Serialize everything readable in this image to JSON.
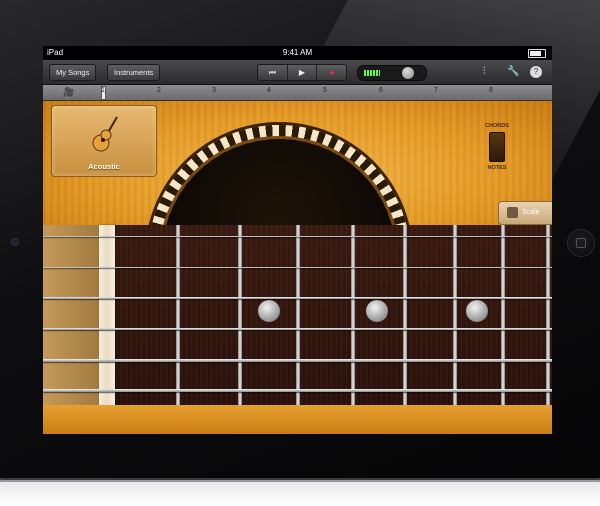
{
  "statusbar": {
    "carrier": "iPad",
    "time": "9:41 AM"
  },
  "toolbar": {
    "my_songs_label": "My Songs",
    "instruments_label": "Instruments",
    "transport": {
      "rewind": "⏮",
      "play": "▶",
      "record": "●"
    },
    "mixer_icon": "⫶",
    "settings_icon": "🔧",
    "help_icon": "?"
  },
  "ruler": {
    "icon": "🎥",
    "measures": [
      "1",
      "2",
      "3",
      "4",
      "5",
      "6",
      "7",
      "8"
    ]
  },
  "instrument": {
    "name": "Acoustic"
  },
  "mode_switch": {
    "top_label": "CHORDS",
    "bottom_label": "NOTES"
  },
  "scales_label": "Scale",
  "colors": {
    "wood": "#e49a25",
    "fretboard": "#2a110a",
    "record": "#ff2a2a",
    "level_meter": "#5dff3a"
  }
}
